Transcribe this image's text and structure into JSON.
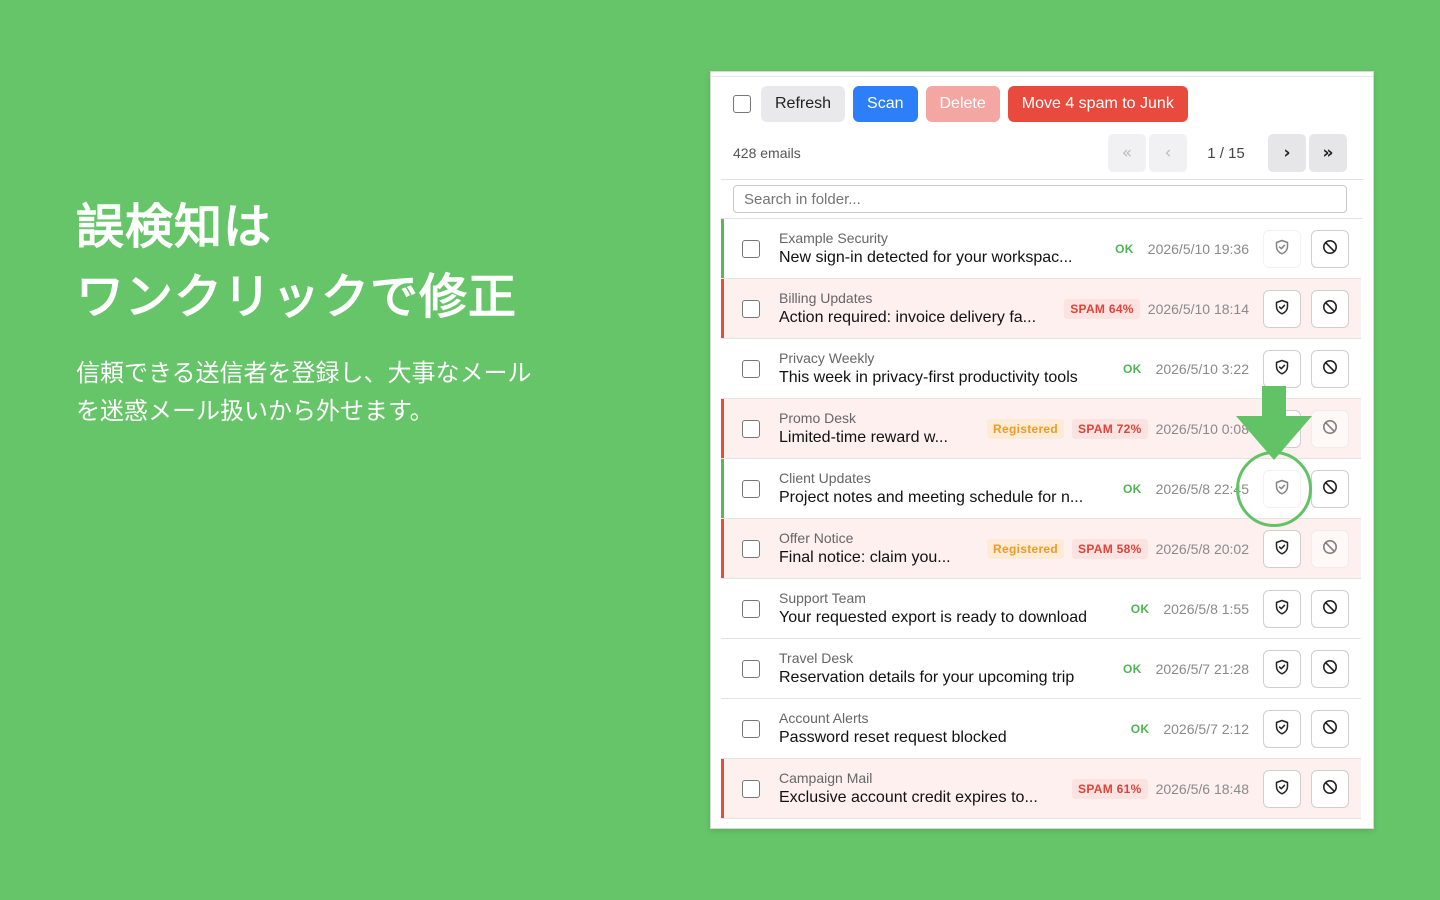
{
  "promo": {
    "headline_line1": "誤検知は",
    "headline_line2": "ワンクリックで修正",
    "body_line1": "信頼できる送信者を登録し、大事なメール",
    "body_line2": "を迷惑メール扱いから外せます。"
  },
  "toolbar": {
    "refresh_label": "Refresh",
    "scan_label": "Scan",
    "delete_label": "Delete",
    "move_label": "Move 4 spam to Junk"
  },
  "pagination": {
    "email_count": "428 emails",
    "first_icon": "«",
    "prev_icon": "‹",
    "page_info": "1 / 15",
    "next_icon": "›",
    "last_icon": "»"
  },
  "search": {
    "placeholder": "Search in folder..."
  },
  "emails": [
    {
      "sender": "Example Security",
      "subject": "New sign-in detected for your workspac...",
      "status": "OK",
      "registered": "",
      "date": "2026/5/10 19:36"
    },
    {
      "sender": "Billing Updates",
      "subject": "Action required: invoice delivery fa...",
      "status": "SPAM 64%",
      "registered": "",
      "date": "2026/5/10 18:14"
    },
    {
      "sender": "Privacy Weekly",
      "subject": "This week in privacy-first productivity tools",
      "status": "OK",
      "registered": "",
      "date": "2026/5/10 3:22"
    },
    {
      "sender": "Promo Desk",
      "subject": "Limited-time reward w...",
      "status": "SPAM 72%",
      "registered": "Registered",
      "date": "2026/5/10 0:08"
    },
    {
      "sender": "Client Updates",
      "subject": "Project notes and meeting schedule for n...",
      "status": "OK",
      "registered": "",
      "date": "2026/5/8 22:45"
    },
    {
      "sender": "Offer Notice",
      "subject": "Final notice: claim you...",
      "status": "SPAM 58%",
      "registered": "Registered",
      "date": "2026/5/8 20:02"
    },
    {
      "sender": "Support Team",
      "subject": "Your requested export is ready to download",
      "status": "OK",
      "registered": "",
      "date": "2026/5/8 1:55"
    },
    {
      "sender": "Travel Desk",
      "subject": "Reservation details for your upcoming trip",
      "status": "OK",
      "registered": "",
      "date": "2026/5/7 21:28"
    },
    {
      "sender": "Account Alerts",
      "subject": "Password reset request blocked",
      "status": "OK",
      "registered": "",
      "date": "2026/5/7 2:12"
    },
    {
      "sender": "Campaign Mail",
      "subject": "Exclusive account credit expires to...",
      "status": "SPAM 61%",
      "registered": "",
      "date": "2026/5/6 18:48"
    }
  ],
  "colors": {
    "background": "#66c569",
    "accent_blue": "#2d7ff9",
    "danger_red": "#e94a3e",
    "ok_green": "#4fb553",
    "registered_orange": "#ef9a2a"
  },
  "icons": {
    "shield": "shield-check-icon",
    "block": "block-icon",
    "pointer": "down-arrow-icon"
  }
}
